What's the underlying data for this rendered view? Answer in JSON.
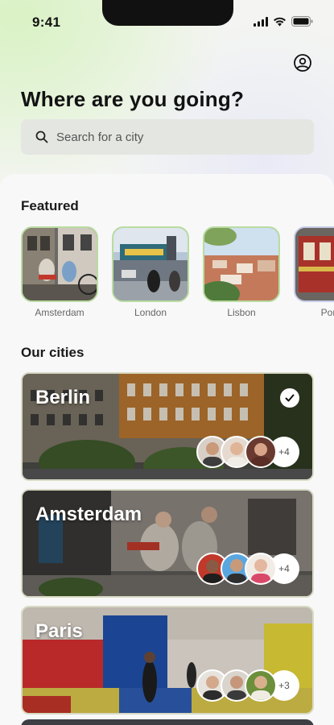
{
  "status": {
    "time": "9:41"
  },
  "header": {
    "title": "Where are you going?"
  },
  "search": {
    "placeholder": "Search for a city"
  },
  "featured": {
    "title": "Featured",
    "items": [
      {
        "label": "Amsterdam"
      },
      {
        "label": "London"
      },
      {
        "label": "Lisbon"
      },
      {
        "label": "Porto"
      }
    ]
  },
  "cities": {
    "title": "Our cities",
    "items": [
      {
        "name": "Berlin",
        "more": "+4",
        "selected": true
      },
      {
        "name": "Amsterdam",
        "more": "+4",
        "selected": false
      },
      {
        "name": "Paris",
        "more": "+3",
        "selected": false
      }
    ]
  }
}
